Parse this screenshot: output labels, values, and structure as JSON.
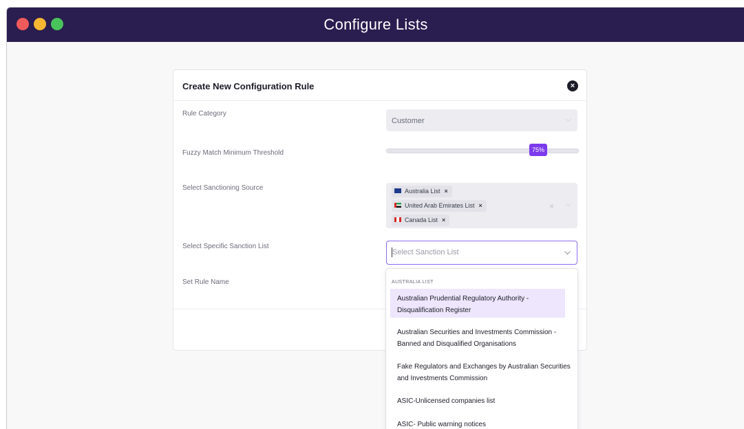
{
  "window": {
    "title": "Configure Lists"
  },
  "modal": {
    "title": "Create New Configuration Rule",
    "close_icon": "close-icon"
  },
  "form": {
    "rule_category": {
      "label": "Rule Category",
      "value": "Customer"
    },
    "fuzzy_match": {
      "label": "Fuzzy Match Minimum Threshold",
      "value_label": "75%",
      "value": 75
    },
    "sanctioning_source": {
      "label": "Select Sanctioning Source",
      "tags": [
        {
          "label": "Australia List",
          "flag": "flag-au-icon"
        },
        {
          "label": "United Arab Emirates List",
          "flag": "flag-ae-icon"
        },
        {
          "label": "Canada List",
          "flag": "flag-ca-icon"
        }
      ],
      "remove_glyph": "×",
      "clear_glyph": "×"
    },
    "sanction_list": {
      "label": "Select Specific Sanction List",
      "placeholder": "Select Sanction List"
    },
    "rule_name": {
      "label": "Set Rule Name"
    }
  },
  "dropdown": {
    "group_label": "AUSTRALIA LIST",
    "options": [
      {
        "label": "Australian Prudential Regulatory Authority - Disqualification Register"
      },
      {
        "label": "Australian Securities and Investments Commission - Banned and Disqualified Organisations"
      },
      {
        "label": "Fake Regulators and Exchanges by Australian Securities and Investments Commission"
      },
      {
        "label": "ASIC-Unlicensed companies list"
      },
      {
        "label": "ASIC- Public warning notices"
      }
    ]
  },
  "colors": {
    "titlebar": "#2a1d4f",
    "accent": "#7c3aed",
    "highlight": "#ede6fc"
  }
}
